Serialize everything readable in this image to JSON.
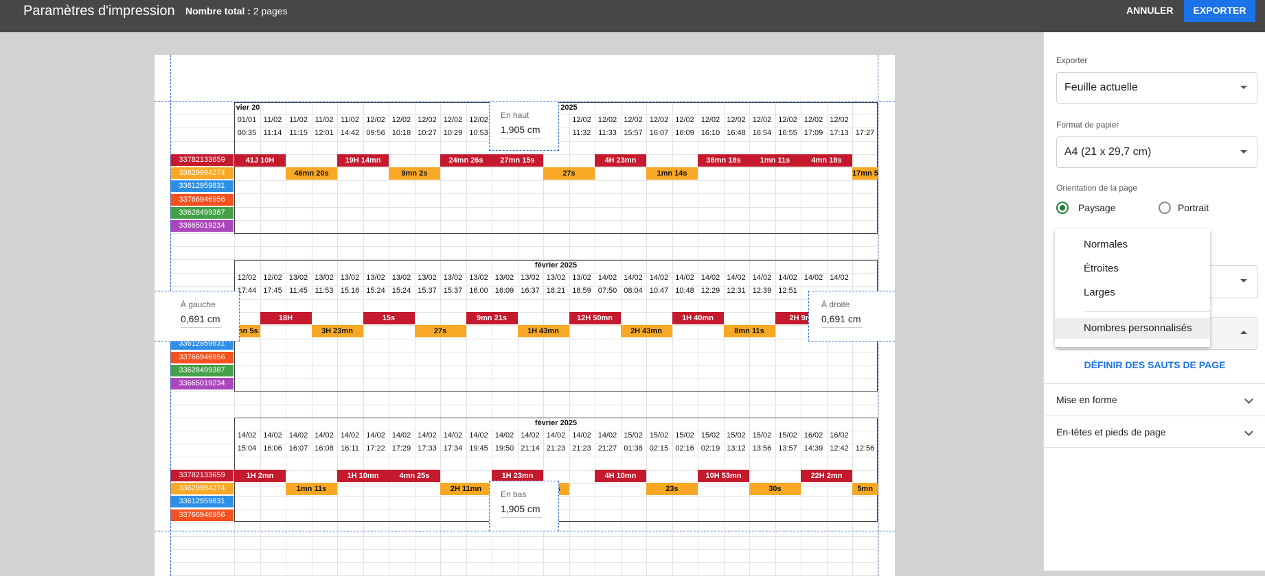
{
  "header": {
    "title": "Paramètres d'impression",
    "total_label": "Nombre total :",
    "total_value": "2 pages",
    "cancel": "ANNULER",
    "export": "EXPORTER"
  },
  "margins": {
    "top": {
      "label": "En haut",
      "value": "1,905 cm"
    },
    "bottom": {
      "label": "En bas",
      "value": "1,905 cm"
    },
    "left": {
      "label": "À gauche",
      "value": "0,691 cm"
    },
    "right": {
      "label": "À droite",
      "value": "0,691 cm"
    }
  },
  "sheet": {
    "labels": [
      "33782133659",
      "33629994274",
      "33612959831",
      "33766946956",
      "33628499387",
      "33665019234"
    ],
    "label_colors": [
      "#c5192d",
      "#f9a825",
      "#2e8fe6",
      "#f4511e",
      "#43a047",
      "#ab47bc"
    ],
    "block1": {
      "month": "février 2025",
      "month_fragment": "vier 20",
      "dates": [
        "01/01",
        "11/02",
        "11/02",
        "11/02",
        "11/02",
        "12/02",
        "12/02",
        "12/02",
        "12/02",
        "12/02",
        "",
        "",
        "2",
        "12/02",
        "12/02",
        "12/02",
        "12/02",
        "12/02",
        "12/02",
        "12/02",
        "12/02",
        "12/02",
        "12/02",
        "12/02"
      ],
      "times": [
        "00:35",
        "11:14",
        "11:15",
        "12:01",
        "14:42",
        "09:56",
        "10:18",
        "10:27",
        "10:29",
        "10:53",
        "",
        "",
        "2",
        "11:32",
        "11:33",
        "15:57",
        "16:07",
        "16:09",
        "16:10",
        "16:48",
        "16:54",
        "16:55",
        "17:09",
        "17:13",
        "17:27"
      ],
      "red_bars": [
        "41J 10H",
        "19H 14mn",
        "24mn 26s",
        "27mn 15s",
        "4H 23mn",
        "38mn 18s",
        "1mn 11s",
        "4mn 18s"
      ],
      "orange_bars": [
        "46mn 20s",
        "9mn 2s",
        "27s",
        "1mn 14s",
        "17mn 5"
      ]
    },
    "block2": {
      "month": "février 2025",
      "dates": [
        "12/02",
        "12/02",
        "13/02",
        "13/02",
        "13/02",
        "13/02",
        "13/02",
        "13/02",
        "13/02",
        "13/02",
        "13/02",
        "13/02",
        "13/02",
        "13/02",
        "14/02",
        "14/02",
        "14/02",
        "14/02",
        "14/02",
        "14/02",
        "14/02",
        "14/02",
        "14/02",
        "14/02"
      ],
      "times": [
        "17:44",
        "17:45",
        "11:45",
        "11:53",
        "15:16",
        "15:24",
        "15:24",
        "15:37",
        "15:37",
        "16:00",
        "16:09",
        "16:37",
        "18:21",
        "18:59",
        "07:50",
        "08:04",
        "10:47",
        "10:48",
        "12:29",
        "12:31",
        "12:39",
        "12:51",
        "",
        ""
      ],
      "red_bars": [
        "18H",
        "15s",
        "9mn 21s",
        "12H 50mn",
        "1H 40mn",
        "2H 9m"
      ],
      "orange_bars": [
        "mn 5s",
        "3H 23mn",
        "27s",
        "1H 43mn",
        "2H 43mn",
        "8mn 11s"
      ]
    },
    "block3": {
      "month": "février 2025",
      "dates": [
        "14/02",
        "14/02",
        "14/02",
        "14/02",
        "14/02",
        "14/02",
        "14/02",
        "14/02",
        "14/02",
        "14/02",
        "14/02",
        "14/02",
        "14/02",
        "14/02",
        "14/02",
        "15/02",
        "15/02",
        "15/02",
        "15/02",
        "15/02",
        "15/02",
        "15/02",
        "16/02",
        "16/02"
      ],
      "times": [
        "15:04",
        "16:06",
        "16:07",
        "16:08",
        "16:11",
        "17:22",
        "17:29",
        "17:33",
        "17:34",
        "19:45",
        "19:50",
        "21:14",
        "21:23",
        "21:23",
        "21:27",
        "01:38",
        "02:15",
        "02:16",
        "02:19",
        "13:12",
        "13:56",
        "13:57",
        "14:39",
        "12:42",
        "12:56"
      ],
      "red_bars": [
        "1H 2mn",
        "1H 10mn",
        "4mn 25s",
        "1H 23mn",
        "4H 10mn",
        "10H 53mn",
        "22H 2mn"
      ],
      "orange_bars": [
        "1mn 11s",
        "2H 11mn",
        "4s",
        "23s",
        "30s",
        "5mn"
      ]
    }
  },
  "sidebar": {
    "export_label": "Exporter",
    "export_value": "Feuille actuelle",
    "paper_label": "Format de papier",
    "paper_value": "A4 (21 x 29,7 cm)",
    "orientation_label": "Orientation de la page",
    "landscape": "Paysage",
    "portrait": "Portrait",
    "margin_options": [
      "Normales",
      "Étroites",
      "Larges",
      "Nombres personnalisés"
    ],
    "define_breaks": "DÉFINIR DES SAUTS DE PAGE",
    "formatting": "Mise en forme",
    "headers_footers": "En-têtes et pieds de page"
  }
}
